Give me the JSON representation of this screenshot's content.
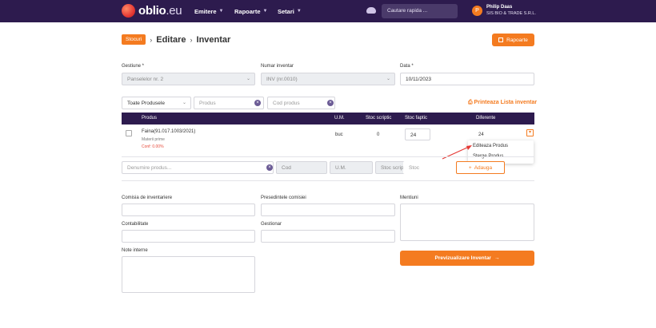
{
  "header": {
    "logo_main": "oblio",
    "logo_ext": ".eu",
    "nav": [
      {
        "label": "Emitere"
      },
      {
        "label": "Rapoarte"
      },
      {
        "label": "Setari"
      }
    ],
    "search_placeholder": "Cautare rapida ...",
    "user_initial": "P",
    "user_name": "Philip Daas",
    "company": "SIS BIO & TRADE S.R.L."
  },
  "breadcrumb": {
    "badge": "Stocuri",
    "items": [
      "Editare",
      "Inventar"
    ]
  },
  "reports_button": "Rapoarte",
  "form": {
    "gestiune_label": "Gestiune *",
    "gestiune_value": "Panselelor nr. 2",
    "numar_label": "Numar inventar",
    "numar_value": "INV (nr.0010)",
    "data_label": "Data *",
    "data_value": "10/11/2023"
  },
  "filters": {
    "products_select": "Toate Produsele",
    "product_placeholder": "Produs",
    "code_placeholder": "Cod produs",
    "print_link": "Printeaza Lista inventar"
  },
  "table": {
    "headers": [
      "Produs",
      "U.M.",
      "Stoc scriptic",
      "Stoc faptic",
      "Diferente"
    ],
    "rows": [
      {
        "product": "Faina(91.017.1003/2021)",
        "category": "Materii prime",
        "note": "Conf: 0.00%",
        "um": "buc",
        "stoc_scriptic": "0",
        "stoc_faptic": "24",
        "diferente": "24"
      }
    ]
  },
  "row_menu": {
    "edit": "Editeaza Produs",
    "delete": "Sterge Produs"
  },
  "add_row": {
    "product_placeholder": "Denumire produs...",
    "code_placeholder": "Cod",
    "um_placeholder": "U.M.",
    "stoc_scriptic_placeholder": "Stoc scriptic",
    "stoc_placeholder": "Stoc",
    "add_button": "Adauga"
  },
  "footer_form": {
    "comisia_label": "Comisia de inventariere",
    "presedinte_label": "Presedintele comisiei",
    "mentiuni_label": "Mentiuni",
    "contabilitate_label": "Contabilitate",
    "gestionar_label": "Gestionar",
    "note_label": "Note interne",
    "preview_button": "Previzualizare Inventar"
  },
  "colors": {
    "navbar": "#2d1b4e",
    "accent": "#f47b20"
  }
}
